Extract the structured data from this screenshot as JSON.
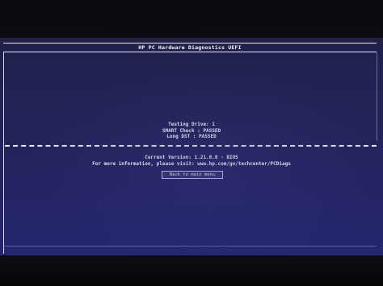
{
  "window": {
    "title": "HP PC Hardware Diagnostics UEFI"
  },
  "status": {
    "testing_drive": "Testing Drive: 1",
    "smart_check": "SMART Check : PASSED",
    "long_dst": "Long DST : PASSED"
  },
  "info": {
    "current_version": "Current Version: 1.21.0.0 - BIOS",
    "more_info": "For more information, please visit: www.hp.com/go/techcenter/PCDiags"
  },
  "actions": {
    "back_label": "Back to main menu"
  },
  "colors": {
    "screen_background": "#23235a",
    "text": "#f0f0f6"
  }
}
